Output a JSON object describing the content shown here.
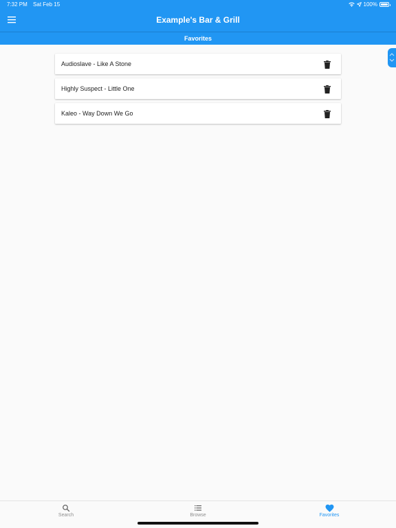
{
  "status": {
    "time": "7:32 PM",
    "date": "Sat Feb 15",
    "battery": "100%"
  },
  "header": {
    "title": "Example's Bar & Grill",
    "menu_icon": "hamburger-menu-icon"
  },
  "subheader": {
    "title": "Favorites"
  },
  "favorites": [
    {
      "label": "Audioslave - Like A Stone"
    },
    {
      "label": "Highly Suspect - Little One"
    },
    {
      "label": "Kaleo - Way Down We Go"
    }
  ],
  "nav": {
    "tabs": [
      {
        "label": "Search",
        "icon": "search-icon",
        "active": false
      },
      {
        "label": "Browse",
        "icon": "list-icon",
        "active": false
      },
      {
        "label": "Favorites",
        "icon": "heart-icon",
        "active": true
      }
    ]
  },
  "colors": {
    "primary": "#2196f3",
    "inactive": "#8e8e8e",
    "background": "#fafafa"
  }
}
